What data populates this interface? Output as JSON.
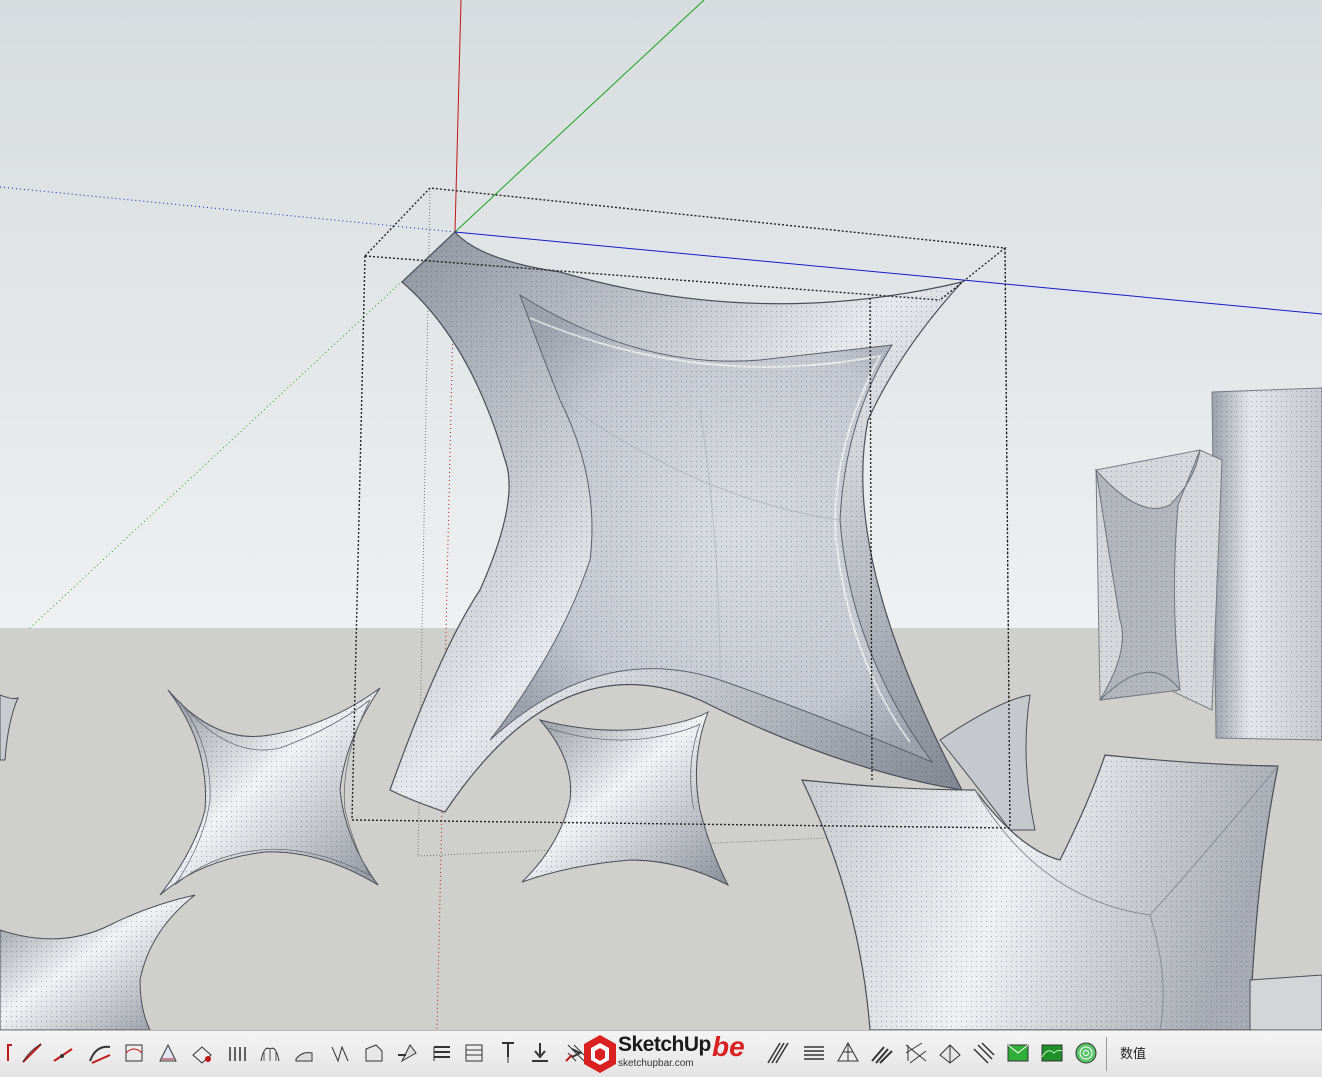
{
  "app": {
    "name": "SketchUp"
  },
  "scene": {
    "sky_color": "#dde1e3",
    "ground_color": "#cfcfcb",
    "axis_colors": {
      "red": "#c01818",
      "green": "#1aa41a",
      "blue": "#1818c8"
    }
  },
  "toolbar": {
    "tools": [
      "line-tool-icon",
      "arc-tool-icon",
      "protractor-icon",
      "curve-tool-icon",
      "bezier-surface-icon",
      "bounding-box-icon",
      "triangulate-icon",
      "grid-surface-icon",
      "loft-icon",
      "extrude-path-icon",
      "twist-icon",
      "sweep-icon",
      "soften-icon",
      "profile-icon",
      "layer-stack-icon",
      "pin-icon",
      "push-down-icon",
      "split-icon",
      "vertex-tools-icon",
      "hatch-icon",
      "stripes-icon",
      "flow-surface-icon",
      "strips-icon",
      "lattice-icon",
      "fold-surface-icon",
      "ribbon-icon",
      "terrain-green-icon",
      "terrain-contour-icon",
      "sandbox-icon"
    ],
    "brand": {
      "name": "SketchUp",
      "suffix": "be",
      "url": "sketchupbar.com",
      "accent_color": "#d92121"
    },
    "measurements_label": "数值",
    "measurements_value": ""
  }
}
